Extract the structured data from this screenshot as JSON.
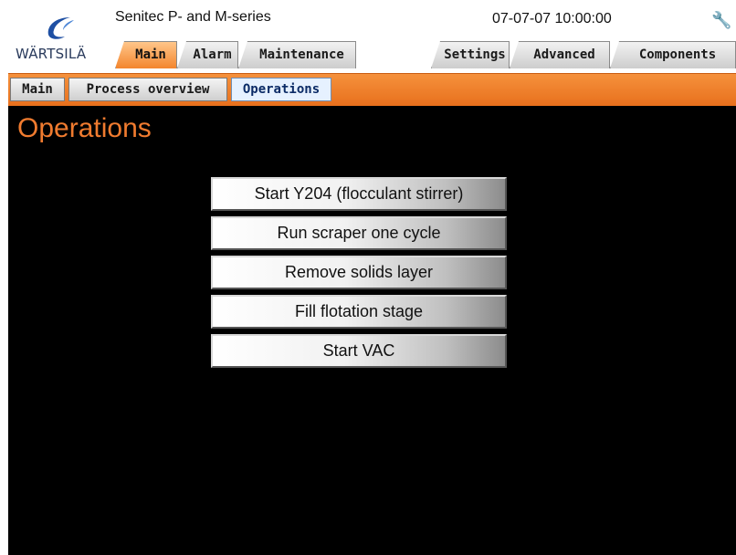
{
  "header": {
    "logo_text": "WÄRTSILÄ",
    "app_title": "Senitec P- and M-series",
    "datetime": "07-07-07 10:00:00",
    "tabs_left": [
      {
        "label": "Main",
        "active": true
      },
      {
        "label": "Alarm",
        "active": false
      },
      {
        "label": "Maintenance",
        "active": false
      }
    ],
    "tabs_right": [
      {
        "label": "Settings",
        "active": false
      },
      {
        "label": "Advanced",
        "active": false
      },
      {
        "label": "Components",
        "active": false
      }
    ],
    "status_icon": "wrench-icon"
  },
  "subnav": {
    "items": [
      {
        "label": "Main",
        "active": false
      },
      {
        "label": "Process overview",
        "active": false
      },
      {
        "label": "Operations",
        "active": true
      }
    ]
  },
  "main": {
    "title": "Operations",
    "buttons": [
      {
        "label": "Start Y204 (flocculant stirrer)"
      },
      {
        "label": "Run scraper one cycle"
      },
      {
        "label": "Remove solids layer"
      },
      {
        "label": "Fill flotation stage"
      },
      {
        "label": "Start VAC"
      }
    ]
  },
  "colors": {
    "accent_orange": "#f07b2f",
    "background": "#000000",
    "header_bg": "#ffffff",
    "logo_blue": "#2a3b5c"
  }
}
